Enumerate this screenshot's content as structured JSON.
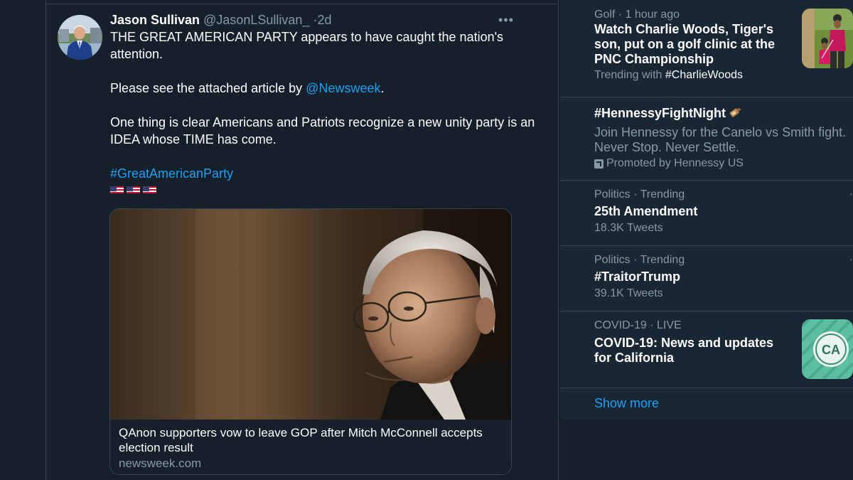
{
  "tweet": {
    "author_name": "Jason Sullivan",
    "author_handle": "@JasonLSullivan_",
    "separator": "·",
    "time": "2d",
    "more_label": "•••",
    "line1": "THE GREAT AMERICAN PARTY appears to have caught the nation's attention.",
    "line2_prefix": "Please see the attached article by ",
    "line2_mention": "@Newsweek",
    "line2_suffix": ".",
    "line3": "One thing is clear Americans and Patriots recognize a new unity party is an IDEA whose TIME has come.",
    "hashtag": "#GreatAmericanParty",
    "flags": [
      "us-flag-icon",
      "us-flag-icon",
      "us-flag-icon"
    ],
    "card": {
      "title": "QAnon supporters vow to leave GOP after Mitch McConnell accepts election result",
      "domain": "newsweek.com"
    }
  },
  "trends": [
    {
      "meta": "Golf",
      "meta_sep": " · ",
      "meta_extra": "1 hour ago",
      "title": "Watch Charlie Woods, Tiger's son, put on a golf clinic at the PNC Championship",
      "sub_prefix": "Trending with ",
      "sub_highlight": "#CharlieWoods",
      "thumb": "golf-photo"
    },
    {
      "title": "#HennessyFightNight",
      "description": "Join Hennessy for the Canelo vs Smith fight. Never Stop. Never Settle.",
      "promoted": "Promoted by Hennessy US",
      "emoji": "bottle-emoji"
    },
    {
      "meta": "Politics · Trending",
      "title": "25th Amendment",
      "sub": "18.3K Tweets"
    },
    {
      "meta": "Politics · Trending",
      "title": "#TraitorTrump",
      "sub": "39.1K Tweets"
    },
    {
      "meta": "COVID-19",
      "meta_sep": " · ",
      "meta_extra": "LIVE",
      "title": "COVID-19: News and updates for California",
      "thumb_label": "CA"
    }
  ],
  "show_more": "Show more",
  "colors": {
    "background": "#15202b",
    "panel": "#192734",
    "border": "#38444d",
    "accent": "#1da1f2",
    "secondary_text": "#8899a6"
  }
}
